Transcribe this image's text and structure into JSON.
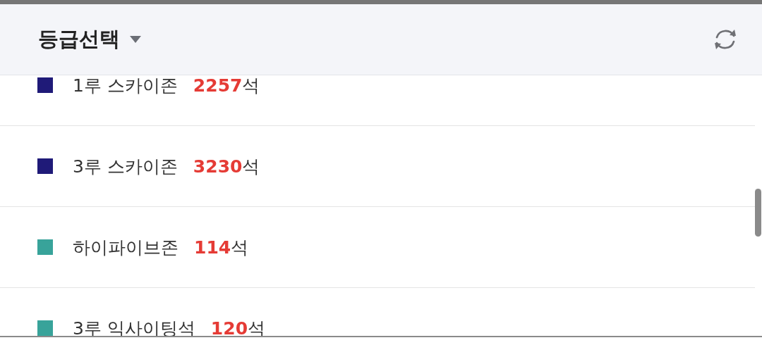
{
  "header": {
    "title": "등급선택"
  },
  "grades": [
    {
      "name": "1루 스카이존",
      "count": "2257",
      "unit": "석",
      "color": "#1f1a78"
    },
    {
      "name": "3루 스카이존",
      "count": "3230",
      "unit": "석",
      "color": "#1f1a78"
    },
    {
      "name": "하이파이브존",
      "count": "114",
      "unit": "석",
      "color": "#38a39a"
    },
    {
      "name": "3루 익사이팅석",
      "count": "120",
      "unit": "석",
      "color": "#38a39a"
    }
  ]
}
